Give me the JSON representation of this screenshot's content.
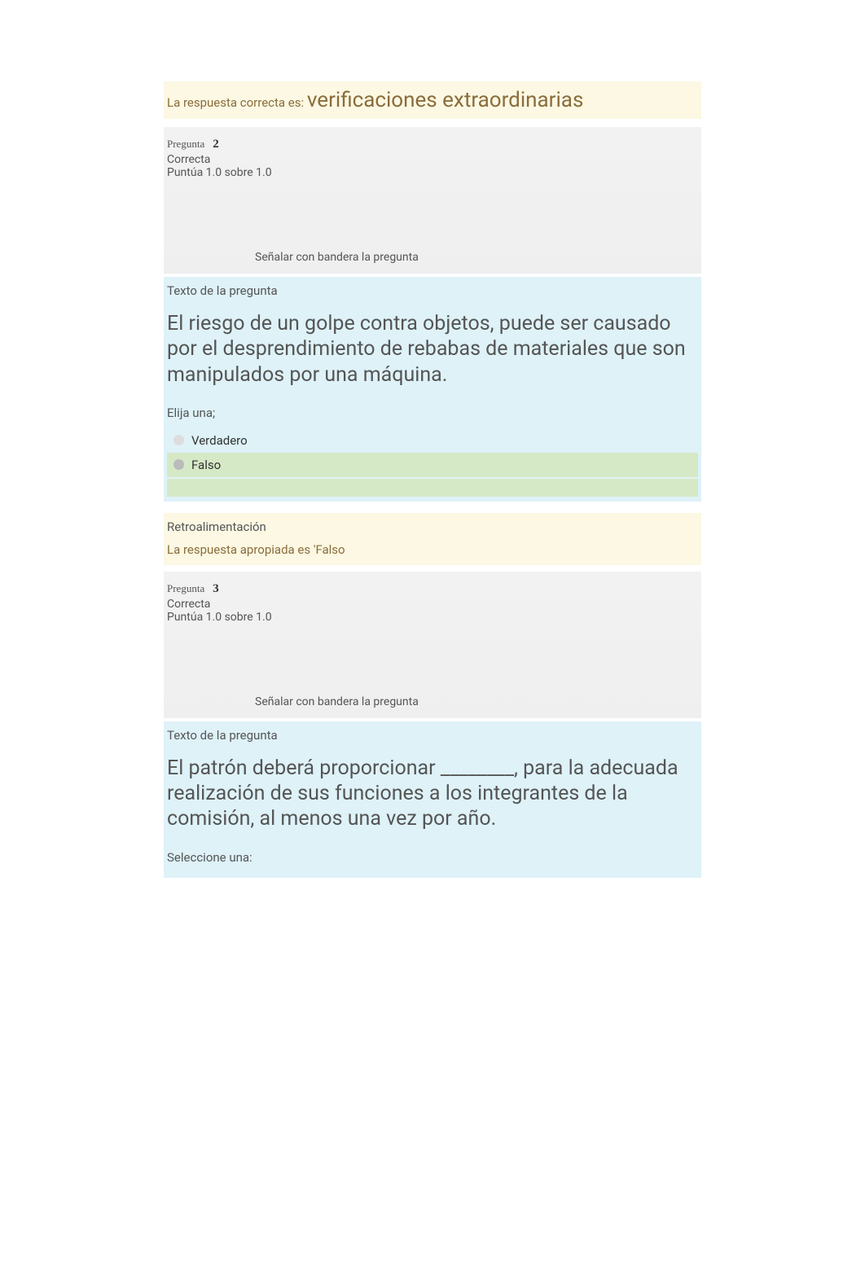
{
  "q1_answer": {
    "prefix": "La respuesta correcta es: ",
    "value": "verificaciones extraordinarias"
  },
  "questions": [
    {
      "label": "Pregunta",
      "number": "2",
      "status": "Correcta",
      "score": "Puntúa 1.0 sobre 1.0",
      "flag_text": "Señalar con bandera la pregunta",
      "text_heading": "Texto de la pregunta",
      "text_body": "El riesgo de un golpe contra objetos, puede ser causado por el desprendimiento de rebabas de materiales que son manipulados por una máquina.",
      "choose_label": "Elija una;",
      "options": [
        {
          "label": "Verdadero",
          "selected": false
        },
        {
          "label": "Falso",
          "selected": true,
          "correct": true
        }
      ],
      "feedback_heading": "Retroalimentación",
      "feedback_text": "La respuesta apropiada es 'Falso"
    },
    {
      "label": "Pregunta",
      "number": "3",
      "status": "Correcta",
      "score": "Puntúa 1.0 sobre 1.0",
      "flag_text": "Señalar con bandera la pregunta",
      "text_heading": "Texto de la pregunta",
      "text_body": "El patrón deberá proporcionar ________, para la adecuada realización de sus funciones a los integrantes de la comisión, al menos una vez por año.",
      "choose_label": "Seleccione una:"
    }
  ]
}
